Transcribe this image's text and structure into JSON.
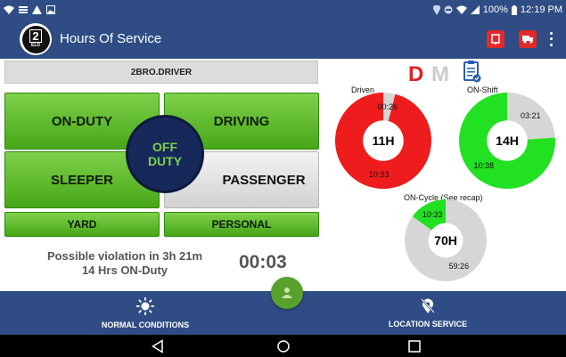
{
  "status_bar": {
    "battery": "100%",
    "time": "12:19 PM",
    "left_icons": [
      "wifi-icon",
      "notes-icon",
      "warning-icon",
      "image-icon"
    ],
    "right_icons": [
      "location-icon",
      "block-icon",
      "wifi-icon",
      "signal-icon",
      "battery-icon"
    ]
  },
  "app_bar": {
    "logo_text": "2",
    "logo_sub": "ELD",
    "title": "Hours Of Service",
    "actions": [
      "inspection-icon",
      "truck-icon",
      "overflow-menu-icon"
    ]
  },
  "driver": {
    "name": "2BRO.DRIVER"
  },
  "status_buttons": {
    "on_duty": "ON-DUTY",
    "driving": "DRIVING",
    "sleeper": "SLEEPER",
    "passenger": "PASSENGER",
    "yard": "YARD",
    "personal": "PERSONAL",
    "off_duty_line1": "OFF",
    "off_duty_line2": "DUTY"
  },
  "violation": {
    "line1": "Possible violation in 3h 21m",
    "line2": "14 Hrs ON-Duty"
  },
  "timer": "00:03",
  "mode": {
    "d": "D",
    "m": "M",
    "d_color": "#e02020",
    "m_color": "#cccccc"
  },
  "charts": {
    "driven": {
      "label": "Driven",
      "center": "11H",
      "used_label": "10:33",
      "remaining_label": "00:26",
      "used_fraction": 0.96,
      "used_color": "#ee1c1c",
      "remaining_color": "#d6d6d6"
    },
    "on_shift": {
      "label": "ON-Shift",
      "center": "14H",
      "used_label": "10:38",
      "remaining_label": "03:21",
      "used_fraction": 0.76,
      "used_color": "#22e022",
      "remaining_color": "#d6d6d6"
    },
    "on_cycle": {
      "label": "ON-Cycle (See recap)",
      "center": "70H",
      "used_label": "10:33",
      "remaining_label": "59:26",
      "used_fraction": 0.15,
      "used_color": "#22e022",
      "remaining_color": "#d6d6d6"
    }
  },
  "bottom_bar": {
    "normal_conditions": "NORMAL CONDITIONS",
    "location_service": "LOCATION SERVICE"
  },
  "colors": {
    "primary": "#2f4d84",
    "button_green": "#5ebd2a",
    "off_duty_bg": "#17295a"
  }
}
